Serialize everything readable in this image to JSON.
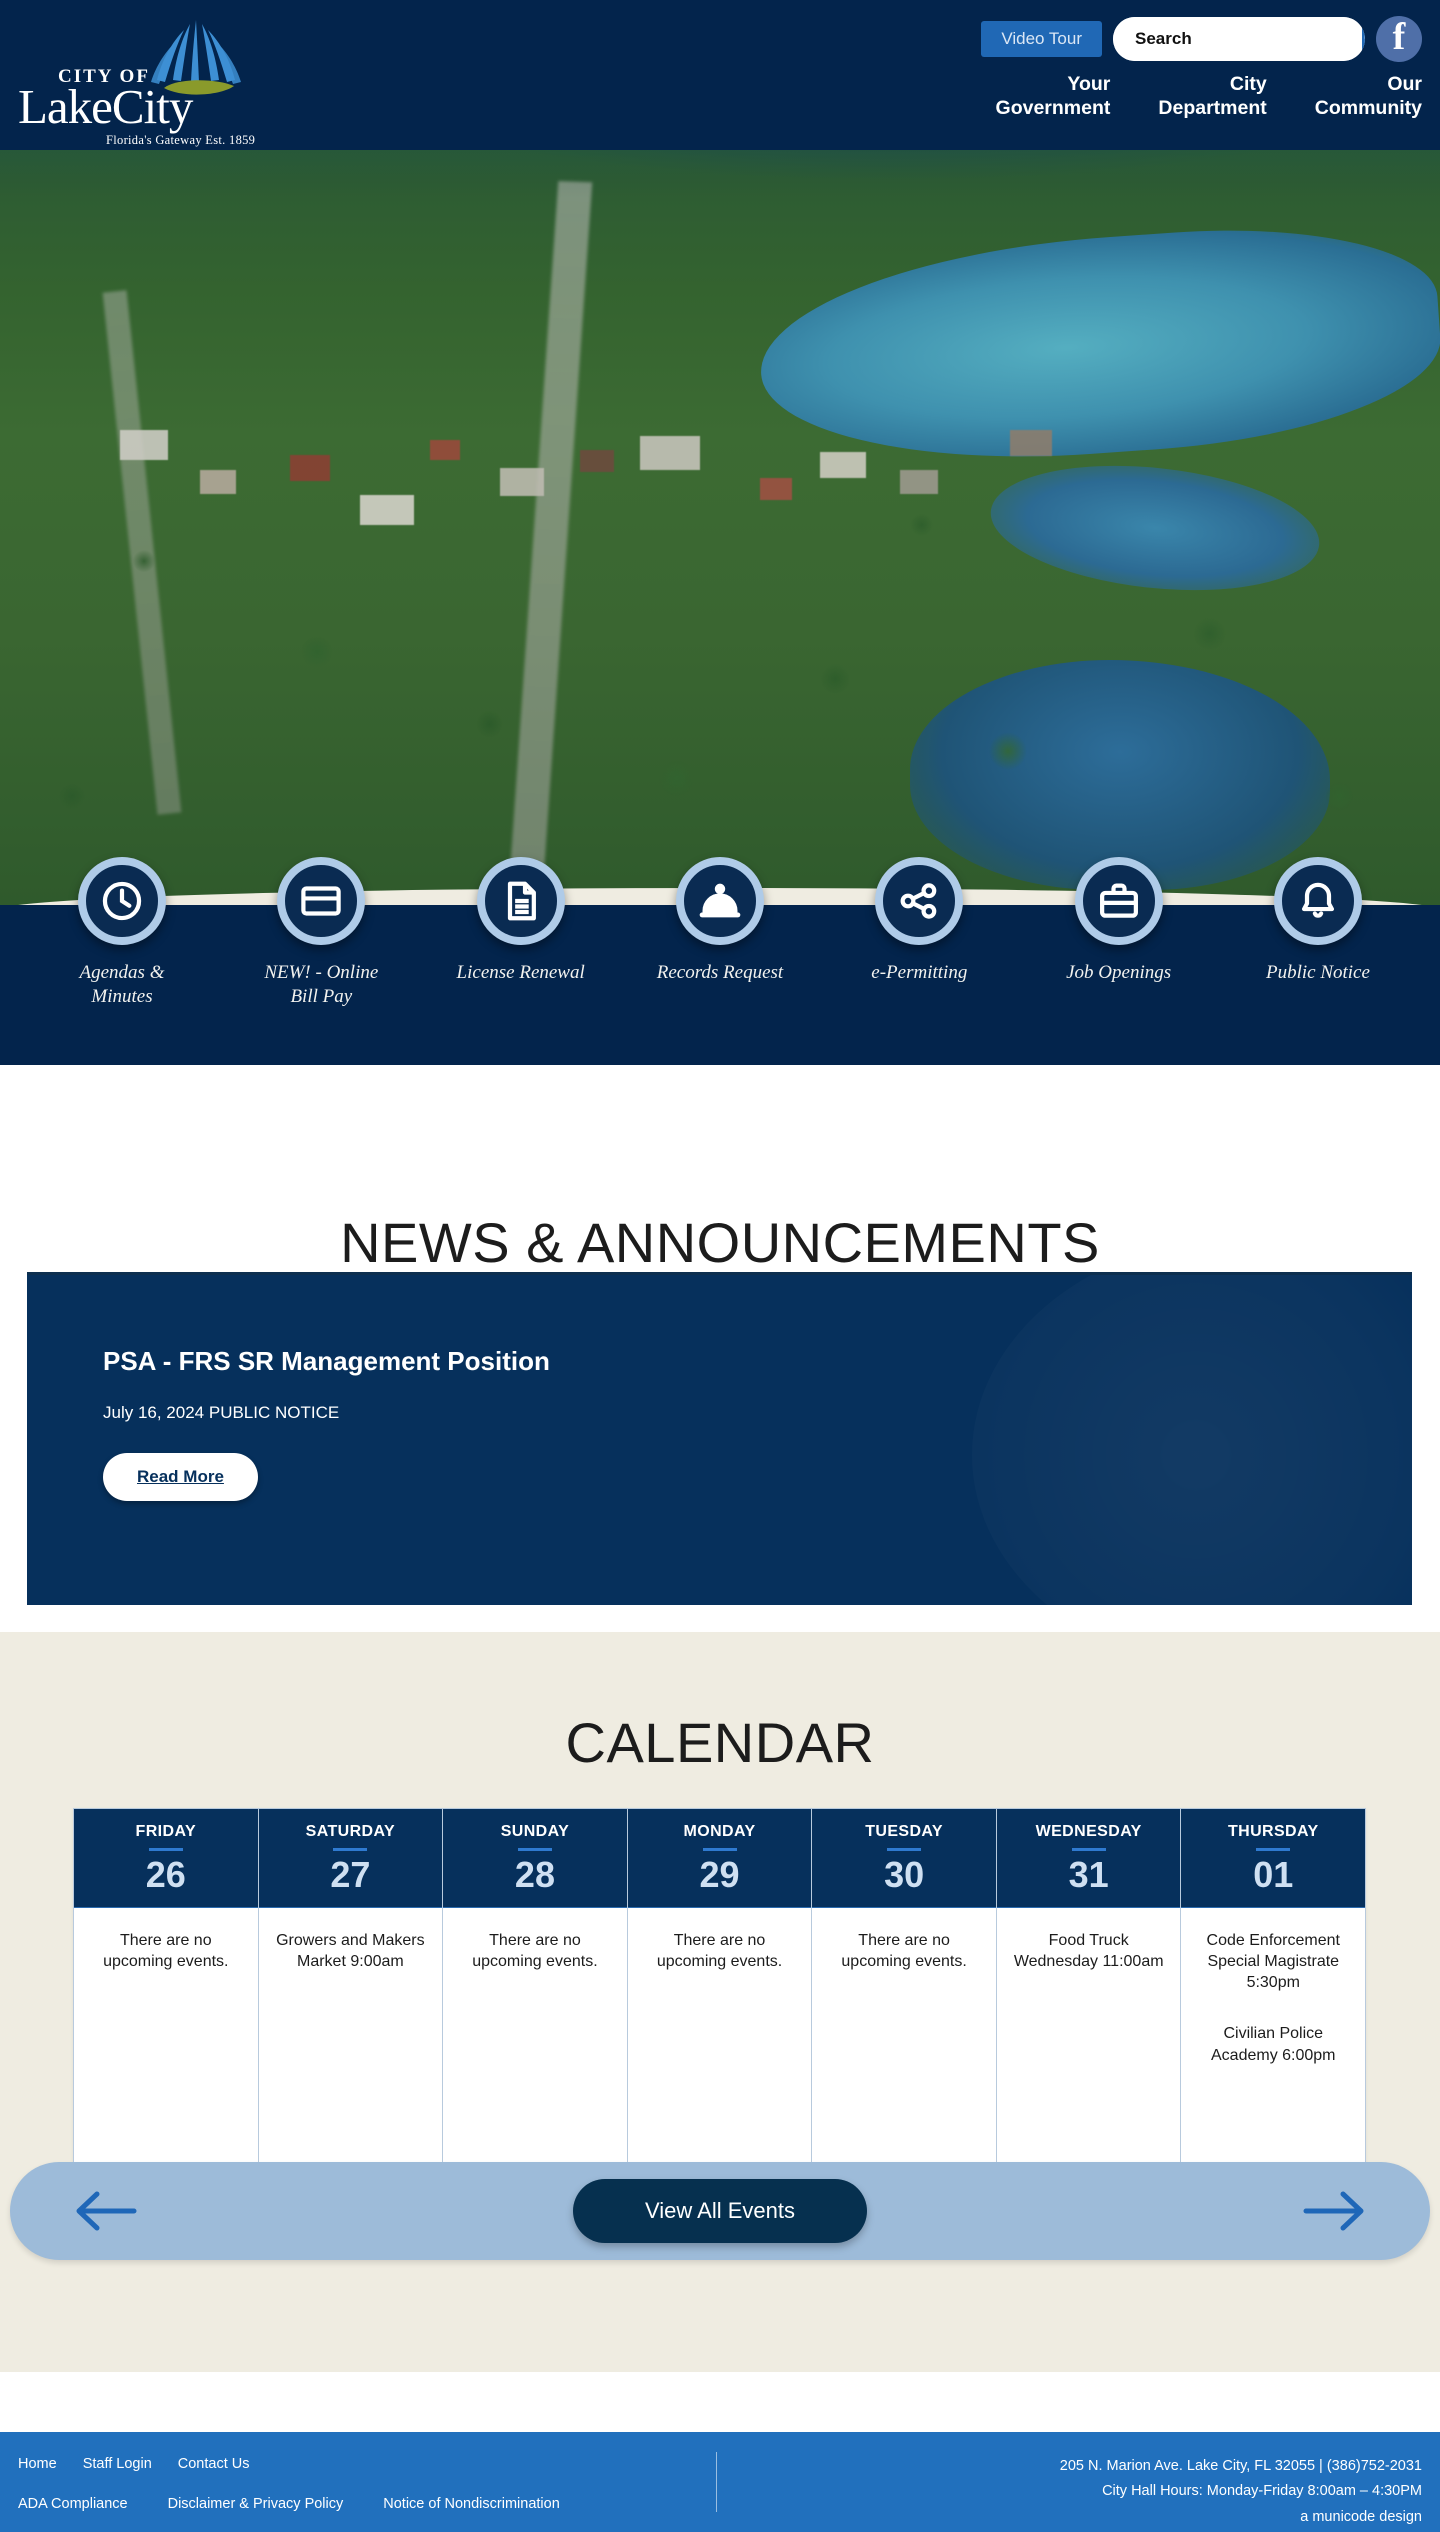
{
  "header": {
    "logo": {
      "line1": "CITY OF",
      "line2": "LakeCity",
      "tagline": "Florida's Gateway Est. 1859"
    },
    "video_tour_label": "Video Tour",
    "search_placeholder": "Search",
    "search_value": "",
    "search_icon": "search-icon",
    "facebook_icon": "facebook-icon",
    "nav": [
      {
        "line1": "Your",
        "line2": "Government"
      },
      {
        "line1": "City",
        "line2": "Department"
      },
      {
        "line1": "Our",
        "line2": "Community"
      }
    ]
  },
  "quicklinks": [
    {
      "icon": "clock-icon",
      "label_line1": "Agendas &",
      "label_line2": "Minutes"
    },
    {
      "icon": "credit-card-icon",
      "label_line1": "NEW! - Online",
      "label_line2": "Bill Pay"
    },
    {
      "icon": "document-icon",
      "label_line1": "License Renewal",
      "label_line2": ""
    },
    {
      "icon": "service-bell-icon",
      "label_line1": "Records Request",
      "label_line2": ""
    },
    {
      "icon": "share-nodes-icon",
      "label_line1": "e-Permitting",
      "label_line2": ""
    },
    {
      "icon": "briefcase-icon",
      "label_line1": "Job Openings",
      "label_line2": ""
    },
    {
      "icon": "bell-icon",
      "label_line1": "Public Notice",
      "label_line2": ""
    }
  ],
  "news": {
    "section_title": "NEWS & ANNOUNCEMENTS",
    "headline": "PSA - FRS SR Management Position",
    "meta": "July 16, 2024 PUBLIC NOTICE",
    "read_more_label": "Read More"
  },
  "calendar": {
    "section_title": "CALENDAR",
    "days": [
      {
        "dow": "FRIDAY",
        "date": "26",
        "events": [
          "There are no upcoming events."
        ]
      },
      {
        "dow": "SATURDAY",
        "date": "27",
        "events": [
          "Growers and Makers Market 9:00am"
        ]
      },
      {
        "dow": "SUNDAY",
        "date": "28",
        "events": [
          "There are no upcoming events."
        ]
      },
      {
        "dow": "MONDAY",
        "date": "29",
        "events": [
          "There are no upcoming events."
        ]
      },
      {
        "dow": "TUESDAY",
        "date": "30",
        "events": [
          "There are no upcoming events."
        ]
      },
      {
        "dow": "WEDNESDAY",
        "date": "31",
        "events": [
          "Food Truck Wednesday 11:00am"
        ]
      },
      {
        "dow": "THURSDAY",
        "date": "01",
        "events": [
          "Code Enforcement Special Magistrate 5:30pm",
          "Civilian Police Academy 6:00pm"
        ]
      }
    ],
    "prev_icon": "arrow-left-icon",
    "next_icon": "arrow-right-icon",
    "view_all_label": "View All Events"
  },
  "footer": {
    "links_row1": [
      "Home",
      "Staff Login",
      "Contact Us"
    ],
    "links_row2": [
      "ADA Compliance",
      "Disclaimer & Privacy Policy",
      "Notice of Nondiscrimination"
    ],
    "address": "205 N. Marion Ave. Lake City, FL 32055 | (386)752-2031",
    "hours": "City Hall Hours: Monday-Friday 8:00am – 4:30PM",
    "credit": "a municode design"
  },
  "colors": {
    "navy": "#03244c",
    "card_navy": "#06305c",
    "accent_blue": "#2068b5",
    "cream": "#efece1",
    "footer_blue": "#2170bd",
    "pale_blue": "#afcbe8"
  }
}
